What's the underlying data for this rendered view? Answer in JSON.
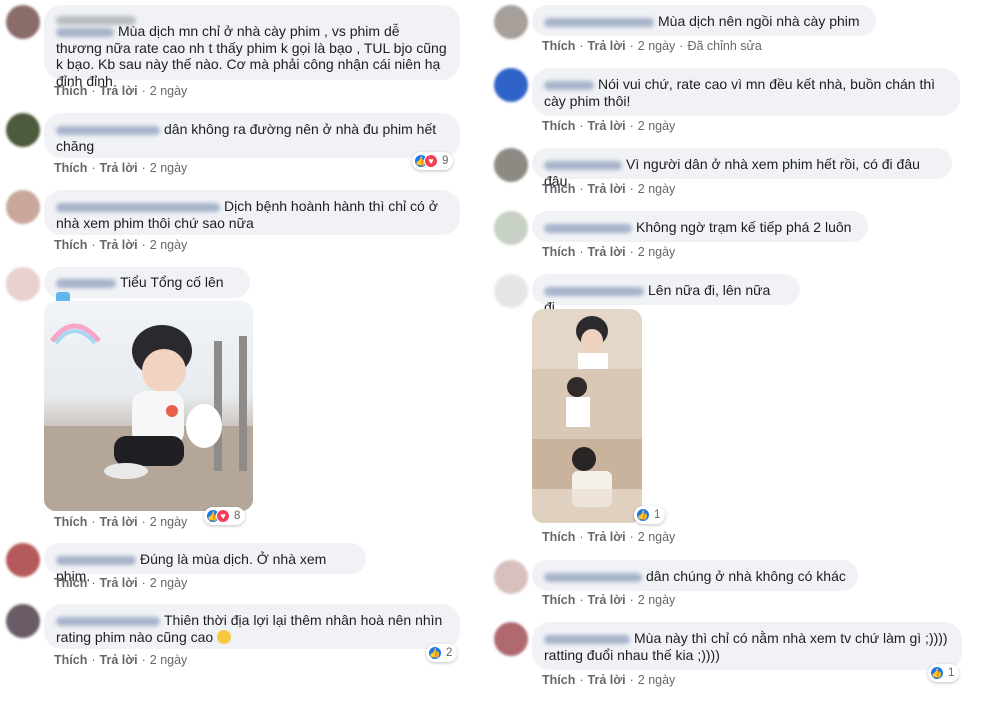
{
  "actions": {
    "like": "Thích",
    "reply": "Trả lời",
    "edited": "Đã chỉnh sửa"
  },
  "comments_left": [
    {
      "text": "Mùa dịch mn chỉ ở nhà cày phim , vs phim dễ thương nữa rate cao nh t thấy phim k gọi là bạo , TUL bjo cũng k bạo. Kb sau này thế nào. Cơ mà phải công nhận cái niên hạ đỉnh đỉnh",
      "time": "2 ngày"
    },
    {
      "text": "dân không ra đường nên ở nhà đu phim hết chăng",
      "time": "2 ngày",
      "reactions": "9"
    },
    {
      "text": "Dịch bệnh hoành hành thì chỉ có ở nhà xem phim thôi chứ sao nữa",
      "time": "2 ngày"
    },
    {
      "text": "Tiểu Tổng cố lên",
      "time": "2 ngày",
      "reactions": "8",
      "emoji": "blue-heart-icon"
    },
    {
      "text": "Đúng là mùa dịch. Ở nhà xem phim.",
      "time": "2 ngày"
    },
    {
      "text": "Thiên thời địa lợi lại thêm nhân hoà nên nhìn rating phim nào cũng cao",
      "time": "2 ngày",
      "reactions": "2",
      "emoji": "astonished-face-icon"
    }
  ],
  "comments_right": [
    {
      "text": "Mùa dịch nên ngồi nhà cày phim",
      "time": "2 ngày",
      "edited": true
    },
    {
      "text": "Nói vui chứ, rate cao vì mn đều kết nhà, buồn chán thì cày phim thôi!",
      "time": "2 ngày"
    },
    {
      "text": "Vì người dân ở nhà xem phim hết rồi, có đi đâu đâu",
      "time": "2 ngày"
    },
    {
      "text": "Không ngờ trạm kế tiếp phá 2 luôn",
      "time": "2 ngày"
    },
    {
      "text": "Lên nữa đi, lên nữa đi.",
      "time": "2 ngày",
      "reactions": "1"
    },
    {
      "text": "dân chúng ở nhà không có khác",
      "time": "2 ngày"
    },
    {
      "text": "Mùa này thì chỉ có nằm nhà xem tv chứ làm gì ;)))) ratting đuổi nhau thế kia ;))))",
      "time": "2 ngày",
      "reactions": "1"
    }
  ],
  "colors": {
    "bubble": "#f0f2f5",
    "meta": "#65676b",
    "like": "#1877f2",
    "love": "#f33e58"
  }
}
